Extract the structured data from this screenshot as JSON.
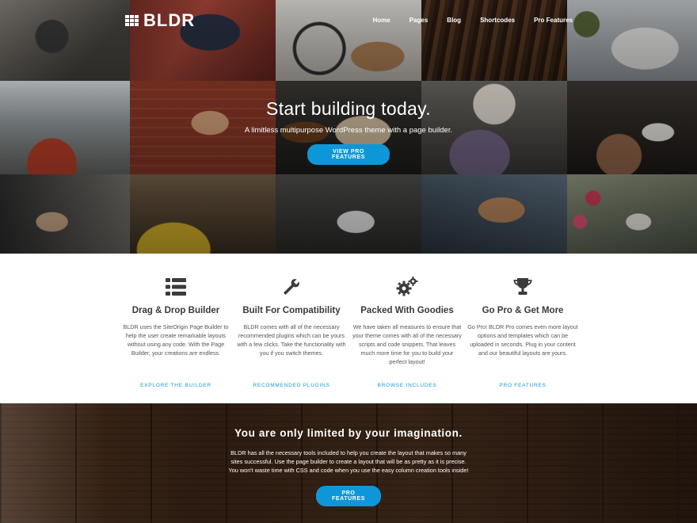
{
  "brand": {
    "logo_text": "BLDR"
  },
  "nav": {
    "items": [
      "Home",
      "Pages",
      "Blog",
      "Shortcodes",
      "Pro Features"
    ]
  },
  "hero": {
    "title": "Start building today.",
    "subtitle": "A limitless multipurpose WordPress theme with a page builder.",
    "button": "VIEW PRO FEATURES"
  },
  "features": [
    {
      "icon": "list-icon",
      "title": "Drag & Drop Builder",
      "description": "BLDR uses the SiteOrigin Page Builder to help the user create remarkable layouts without using any code. With the Page Builder, your creations are endless.",
      "link": "EXPLORE THE BUILDER"
    },
    {
      "icon": "wrench-icon",
      "title": "Built For Compatibility",
      "description": "BLDR comes with all of the necessary recommended plugins which can be yours with a few clicks. Take the functionality with you if you switch themes.",
      "link": "RECOMMENDED PLUGINS"
    },
    {
      "icon": "gears-icon",
      "title": "Packed With Goodies",
      "description": "We have taken all measures to ensure that your theme comes with all of the necessary scripts and code snippets. That leaves much more time for you to build your perfect layout!",
      "link": "BROWSE INCLUDES"
    },
    {
      "icon": "trophy-icon",
      "title": "Go Pro & Get More",
      "description": "Go Pro! BLDR Pro comes even more layout options and templates which can be uploaded in seconds. Plug in your content and our beautiful layouts are yours.",
      "link": "PRO FEATURES"
    }
  ],
  "banner": {
    "title": "You are only limited by your imagination.",
    "description": "BLDR has all the necessary tools included to help you create the layout that makes so many sites successful. Use the page builder to create a layout that will be as pretty as it is precise. You won't waste time with CSS and code when you use the easy column creation tools inside!",
    "button": "PRO FEATURES"
  },
  "colors": {
    "accent": "#0e97d8",
    "link": "#1d97d8"
  }
}
